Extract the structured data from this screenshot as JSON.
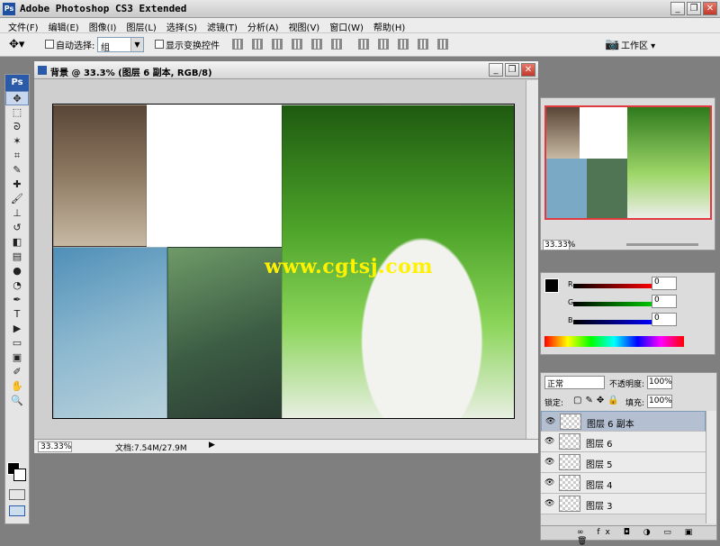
{
  "app": {
    "title": "Adobe Photoshop CS3 Extended",
    "logo": "Ps"
  },
  "menu": [
    "文件(F)",
    "编辑(E)",
    "图像(I)",
    "图层(L)",
    "选择(S)",
    "滤镜(T)",
    "分析(A)",
    "视图(V)",
    "窗口(W)",
    "帮助(H)"
  ],
  "options": {
    "auto_select_label": "自动选择:",
    "auto_select_value": "组",
    "show_transform_label": "显示变换控件",
    "workspace_label": "工作区 ▾"
  },
  "document": {
    "title": "背景 @ 33.3% (图层 6 副本, RGB/8)",
    "zoom": "33.33%",
    "doc_info": "文档:7.54M/27.9M",
    "watermark": "www.cgtsj.com"
  },
  "navigator": {
    "zoom": "33.33%"
  },
  "color_panel": {
    "r_label": "R",
    "g_label": "G",
    "b_label": "B",
    "r": "0",
    "g": "0",
    "b": "0"
  },
  "layers": {
    "blend_mode": "正常",
    "opacity_label": "不透明度:",
    "opacity": "100%",
    "lock_label": "锁定:",
    "fill_label": "填充:",
    "fill": "100%",
    "items": [
      {
        "name": "图层 6 副本",
        "selected": true
      },
      {
        "name": "图层 6",
        "selected": false
      },
      {
        "name": "图层 5",
        "selected": false
      },
      {
        "name": "图层 4",
        "selected": false
      },
      {
        "name": "图层 3",
        "selected": false
      }
    ]
  }
}
